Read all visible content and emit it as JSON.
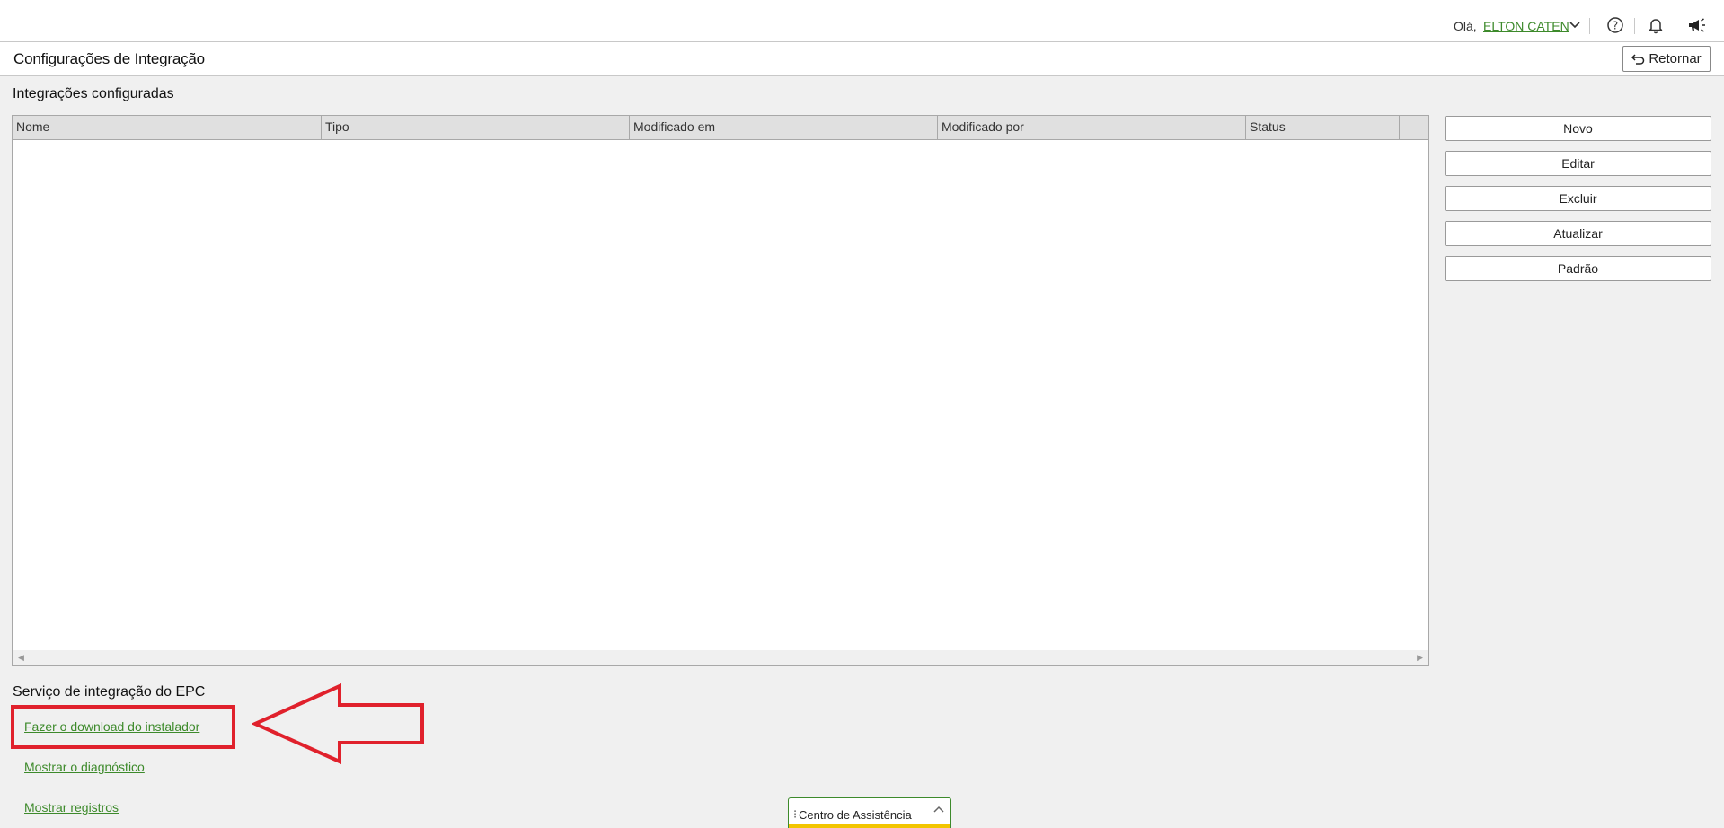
{
  "header": {
    "greeting": "Olá,",
    "user_name": "ELTON CATEN",
    "icons": [
      "chevron-down-icon",
      "help-icon",
      "bell-icon",
      "megaphone-icon"
    ]
  },
  "titlebar": {
    "title": "Configurações de Integração",
    "return_label": "Retornar"
  },
  "integrations": {
    "heading": "Integrações configuradas",
    "columns": [
      "Nome",
      "Tipo",
      "Modificado em",
      "Modificado por",
      "Status"
    ],
    "rows": []
  },
  "actions": {
    "new": "Novo",
    "edit": "Editar",
    "delete": "Excluir",
    "refresh": "Atualizar",
    "default": "Padrão"
  },
  "epc_service": {
    "heading": "Serviço de integração do EPC",
    "download_link": "Fazer o download do instalador",
    "diagnostic_link": "Mostrar o diagnóstico",
    "logs_link": "Mostrar registros"
  },
  "assistance": {
    "label": "Centro de Assistência"
  },
  "colors": {
    "link_green": "#3d8a2b",
    "annotation_red": "#e0212c",
    "assist_bar_yellow": "#f2c500"
  }
}
